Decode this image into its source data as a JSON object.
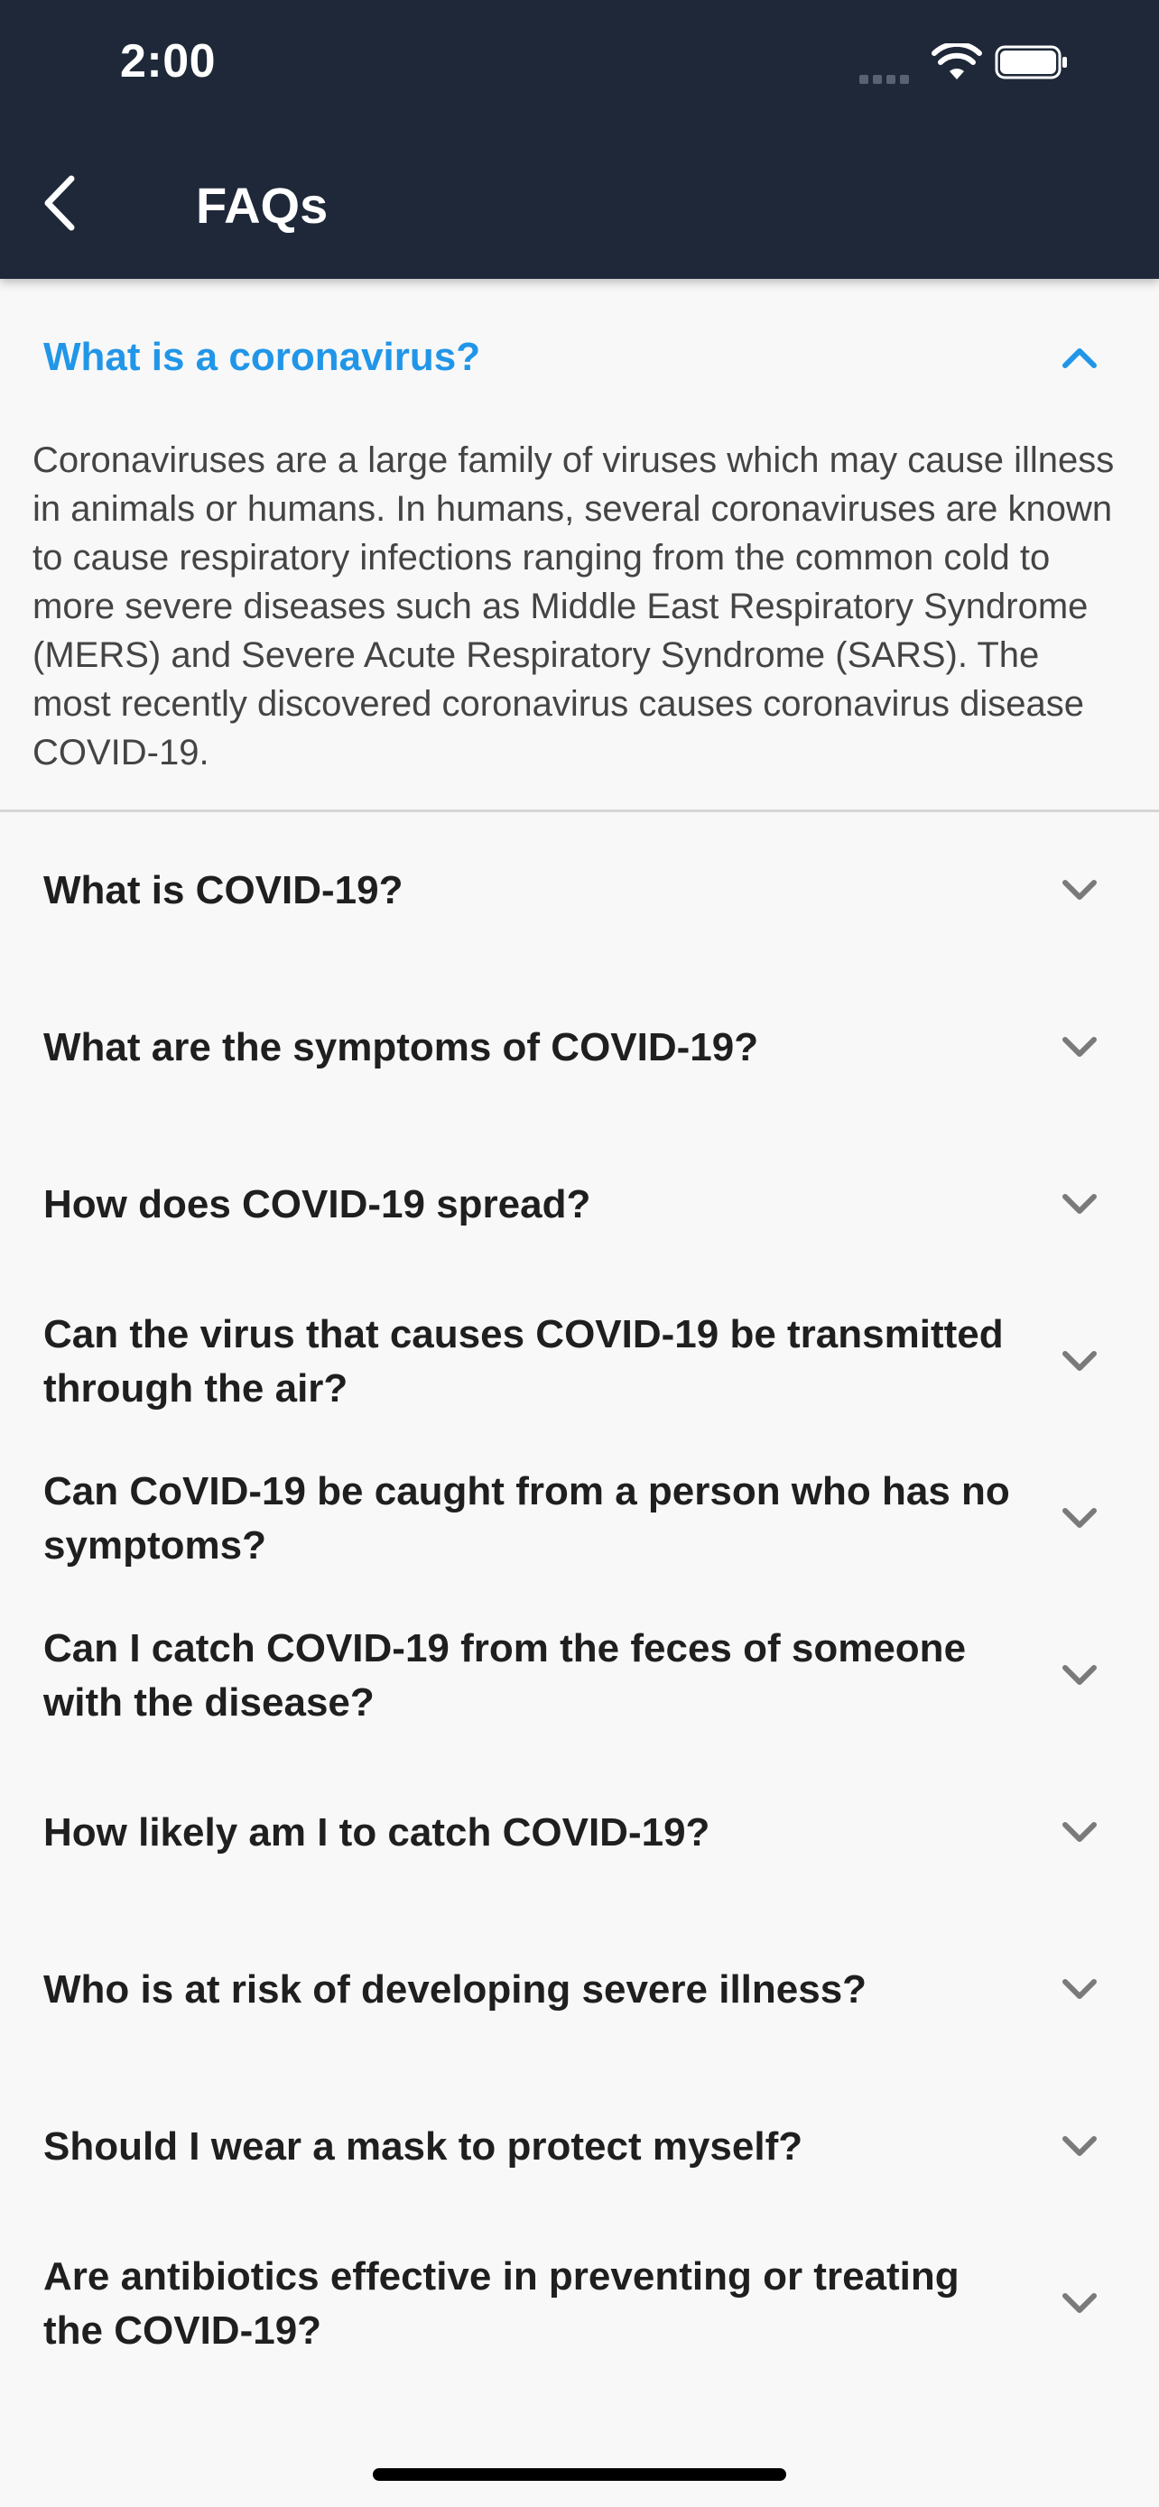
{
  "status_bar": {
    "time": "2:00",
    "icons": [
      "signal-icon",
      "wifi-icon",
      "battery-icon"
    ]
  },
  "nav": {
    "back_icon": "chevron-left-icon",
    "title": "FAQs"
  },
  "colors": {
    "header_bg": "#1e2838",
    "accent": "#2196e8",
    "page_bg": "#f8f8f8"
  },
  "faqs": [
    {
      "question": "What is a coronavirus?",
      "expanded": true,
      "answer": "Coronaviruses are a large family of viruses which may cause illness in animals or humans.  In humans, several coronaviruses are known to cause respiratory infections ranging from the common cold to more severe diseases such as Middle East Respiratory Syndrome (MERS) and Severe Acute Respiratory Syndrome (SARS). The most recently discovered coronavirus causes coronavirus disease COVID-19."
    },
    {
      "question": "What is COVID-19?",
      "expanded": false
    },
    {
      "question": "What are the symptoms of COVID-19?",
      "expanded": false
    },
    {
      "question": "How does COVID-19 spread?",
      "expanded": false
    },
    {
      "question": "Can the virus that causes COVID-19 be transmitted through the air?",
      "expanded": false
    },
    {
      "question": "Can CoVID-19 be caught from a person who has no symptoms?",
      "expanded": false
    },
    {
      "question": "Can I catch COVID-19 from the feces of someone with the disease?",
      "expanded": false
    },
    {
      "question": "How likely am I to catch COVID-19?",
      "expanded": false
    },
    {
      "question": "Who is at risk of developing severe illness?",
      "expanded": false
    },
    {
      "question": "Should I wear a mask to protect myself?",
      "expanded": false
    },
    {
      "question": "Are antibiotics effective in preventing or treating the COVID-19?",
      "expanded": false
    }
  ]
}
